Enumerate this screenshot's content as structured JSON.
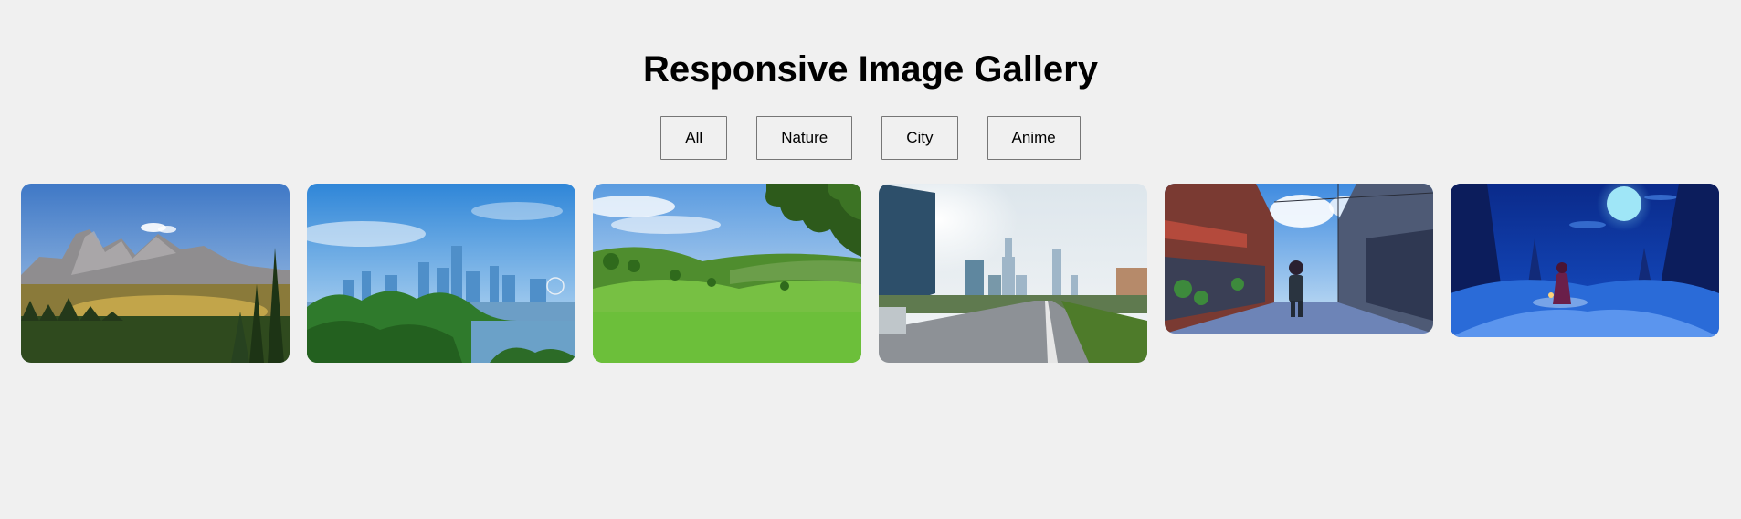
{
  "page": {
    "title": "Responsive Image Gallery"
  },
  "filters": [
    {
      "label": "All",
      "value": "all"
    },
    {
      "label": "Nature",
      "value": "nature"
    },
    {
      "label": "City",
      "value": "city"
    },
    {
      "label": "Anime",
      "value": "anime"
    }
  ],
  "gallery": {
    "items": [
      {
        "category": "nature",
        "subject": "mountain-forest"
      },
      {
        "category": "city",
        "subject": "skyline-park"
      },
      {
        "category": "nature",
        "subject": "green-meadow"
      },
      {
        "category": "city",
        "subject": "city-road"
      },
      {
        "category": "anime",
        "subject": "anime-street"
      },
      {
        "category": "anime",
        "subject": "anime-moon-night"
      }
    ]
  }
}
